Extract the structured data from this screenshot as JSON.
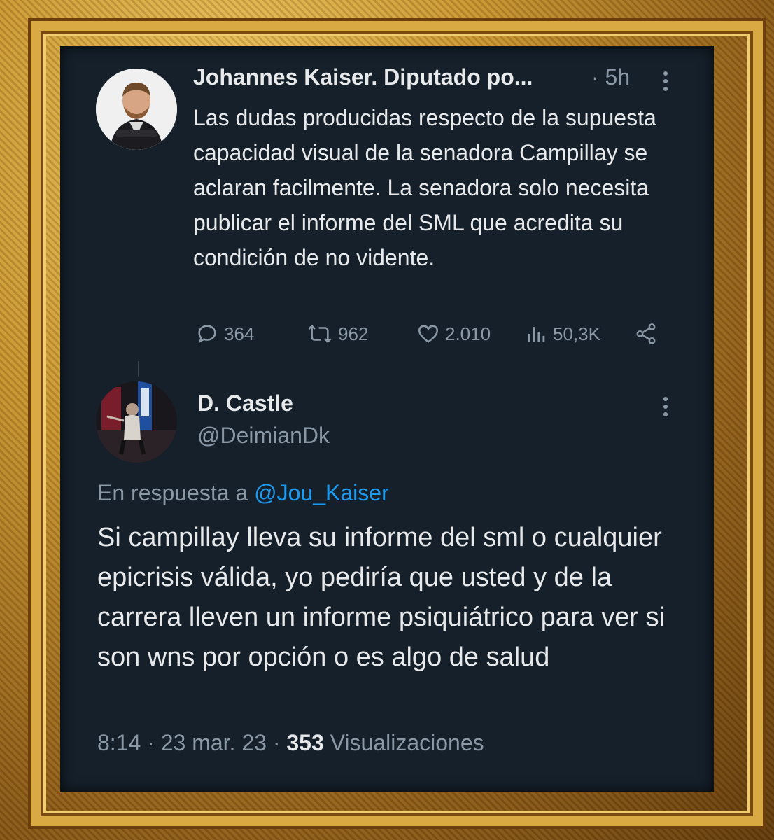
{
  "original_tweet": {
    "author": "Johannes Kaiser. Diputado po...",
    "separator": "·",
    "time": "5h",
    "text": "Las dudas producidas respecto de la supuesta capacidad visual de la senadora Campillay se aclaran facilmente. La senadora solo necesita publicar el informe del SML que acredita su condición de no vidente.",
    "stats": {
      "replies": "364",
      "retweets": "962",
      "likes": "2.010",
      "views": "50,3K"
    }
  },
  "reply_tweet": {
    "author": "D. Castle",
    "handle": "@DeimianDk",
    "reply_label": "En respuesta a",
    "reply_handle": "@Jou_Kaiser",
    "text": "Si campillay lleva su informe del sml o cualquier epicrisis válida, yo pediría que usted y de la carrera lleven un informe psiquiátrico para ver si son wns por opción o es algo de salud",
    "time": "8:14",
    "date": "23 mar. 23",
    "views_count": "353",
    "views_label": "Visualizaciones",
    "separator": "·"
  },
  "colors": {
    "background": "#15202b",
    "text": "#e7e9ea",
    "muted": "#8b98a5",
    "link": "#1d9bf0",
    "frame": "#c8962f"
  }
}
